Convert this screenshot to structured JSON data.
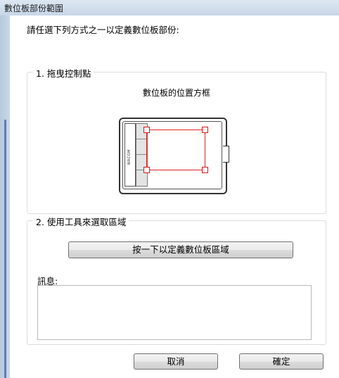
{
  "window": {
    "title": "數位板部份範圍"
  },
  "instruction": "請任選下列方式之一以定義數位板部份:",
  "drag_group": {
    "legend": "1. 拖曳控制點",
    "caption": "數位板的位置方框",
    "tablet_brand": "WACOM"
  },
  "tool_group": {
    "legend": "2. 使用工具來選取區域",
    "define_button": "按一下以定義數位板區域",
    "message_label": "訊息:",
    "message_text": ""
  },
  "buttons": {
    "cancel": "取消",
    "ok": "確定"
  },
  "colors": {
    "selection": "#e0201e",
    "title_bar": "#c7d6e8",
    "accent": "#5b7fb0"
  }
}
